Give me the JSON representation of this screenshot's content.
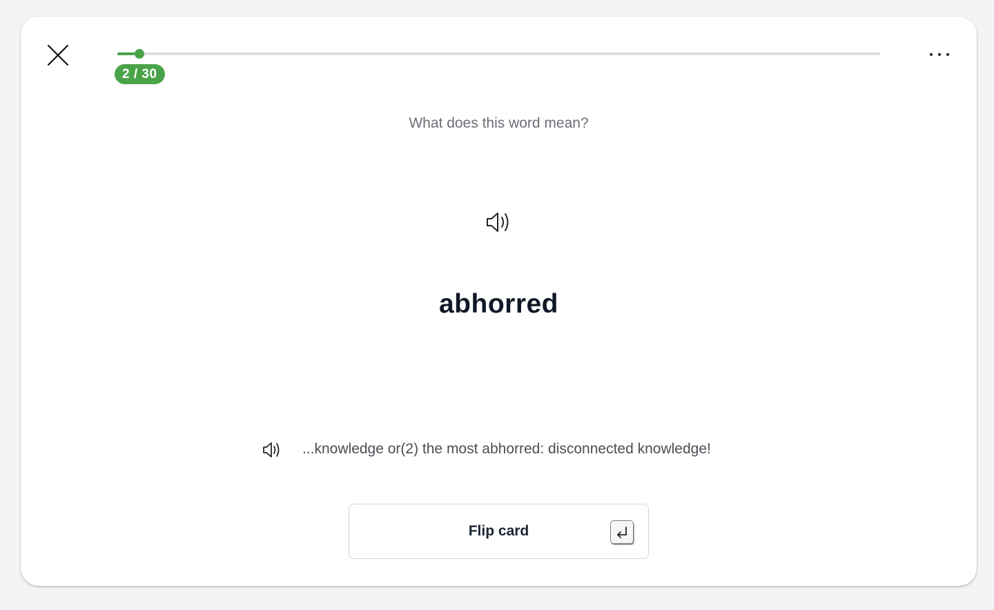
{
  "progress": {
    "current": 2,
    "total": 30,
    "label": "2 / 30",
    "fraction": 0.029,
    "accent_color": "#4aa349"
  },
  "header": {
    "close_icon": "close-icon",
    "menu_icon": "more-horizontal-icon"
  },
  "card": {
    "prompt": "What does this word mean?",
    "audio_icon": "speaker-icon",
    "word": "abhorred",
    "example_audio_icon": "speaker-icon",
    "example_sentence": "...knowledge or(2) the most abhorred: disconnected knowledge!"
  },
  "actions": {
    "flip_label": "Flip card",
    "flip_shortcut_icon": "enter-key-icon"
  }
}
